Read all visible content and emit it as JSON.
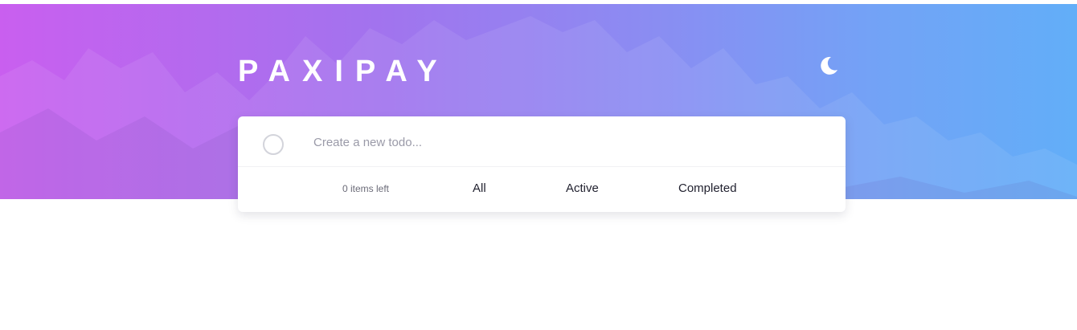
{
  "header": {
    "brand": "PAXIPAY",
    "theme_icon": "moon-icon"
  },
  "todo": {
    "input_placeholder": "Create a new todo...",
    "input_value": ""
  },
  "footer": {
    "items_left": "0 items left",
    "filters": [
      "All",
      "Active",
      "Completed"
    ]
  },
  "colors": {
    "gradient_start": "#c95fef",
    "gradient_end": "#62aef8",
    "card_bg": "#ffffff",
    "circle_border": "#d3d4db"
  }
}
